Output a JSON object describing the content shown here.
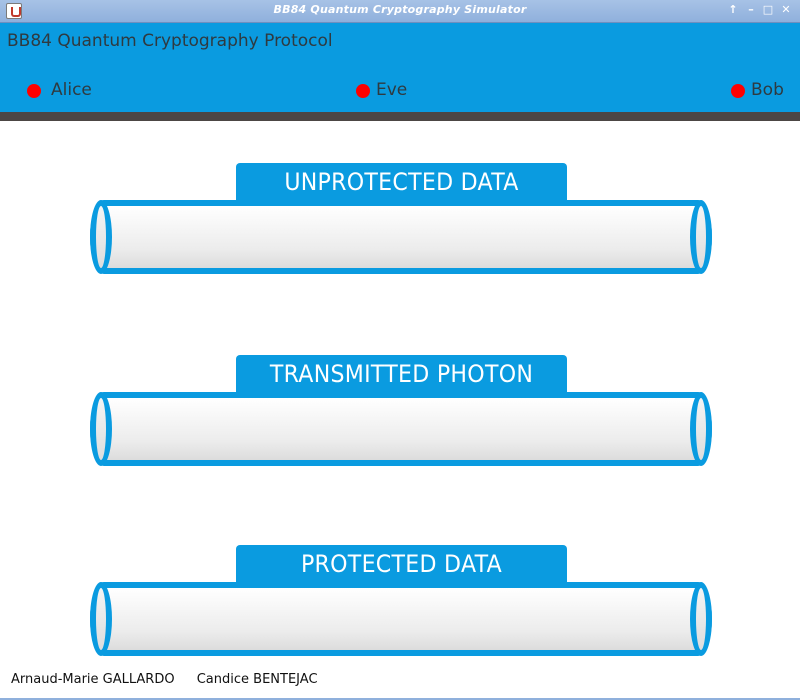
{
  "window": {
    "title": "BB84 Quantum Cryptography Simulator",
    "controls": [
      "↑",
      "–",
      "□",
      "✕"
    ]
  },
  "header": {
    "title": "BB84 Quantum Cryptography Protocol",
    "parties": [
      {
        "name": "Alice",
        "status_color": "#ff0000"
      },
      {
        "name": "Eve",
        "status_color": "#ff0000"
      },
      {
        "name": "Bob",
        "status_color": "#ff0000"
      }
    ]
  },
  "channels": [
    {
      "label": "UNPROTECTED DATA"
    },
    {
      "label": "TRANSMITTED PHOTON"
    },
    {
      "label": "PROTECTED DATA"
    }
  ],
  "credits": [
    "Arnaud-Marie GALLARDO",
    "Candice BENTEJAC"
  ],
  "colors": {
    "accent": "#0a9be0",
    "divider": "#4c4644",
    "status_off": "#ff0000"
  }
}
